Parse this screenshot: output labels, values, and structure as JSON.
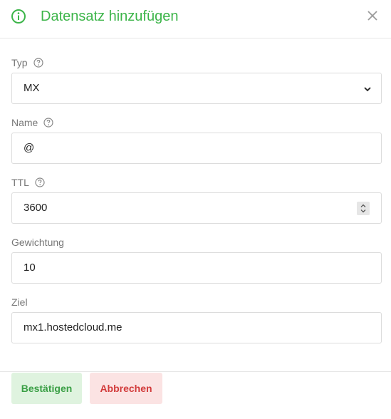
{
  "dialog": {
    "title": "Datensatz hinzufügen",
    "accent_color": "#3db54a"
  },
  "form": {
    "type": {
      "label": "Typ",
      "value": "MX"
    },
    "name": {
      "label": "Name",
      "value": "@"
    },
    "ttl": {
      "label": "TTL",
      "value": "3600"
    },
    "weight": {
      "label": "Gewichtung",
      "value": "10"
    },
    "target": {
      "label": "Ziel",
      "value": "mx1.hostedcloud.me"
    }
  },
  "footer": {
    "confirm_label": "Bestätigen",
    "cancel_label": "Abbrechen"
  },
  "icons": {
    "header": "info-circle-icon",
    "close": "close-icon",
    "help": "question-circle-icon",
    "select": "chevron-down-icon",
    "stepper": "spin-stepper-icon"
  }
}
